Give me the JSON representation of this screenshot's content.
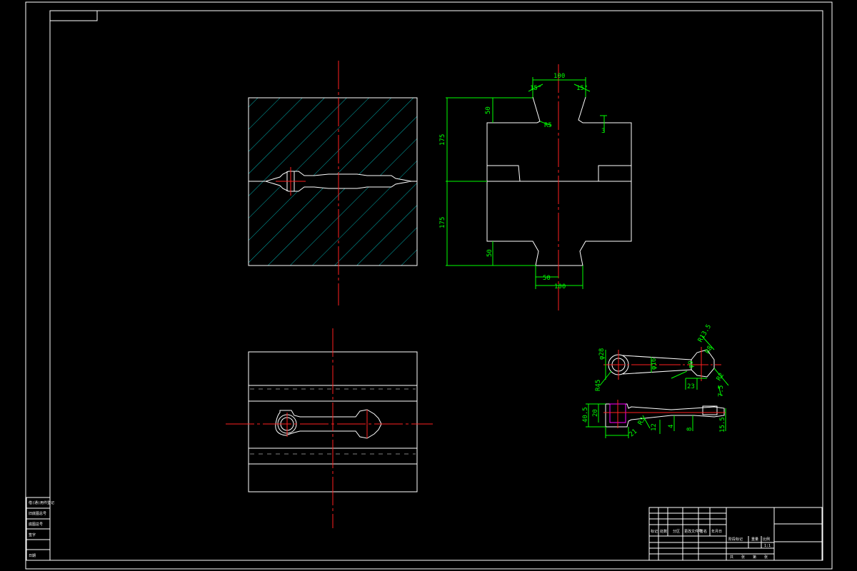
{
  "dimensions": {
    "top_width": "100",
    "top_left_angle": "15°",
    "top_right_angle": "15°",
    "top_radius": "R5",
    "left_top_depth": "50",
    "left_upper_height": "175",
    "left_lower_height": "175",
    "left_bottom_depth": "50",
    "right_notch": "3",
    "bottom_inner_width": "50",
    "bottom_outer_width": "100"
  },
  "part_top_view": {
    "d1": "φ28",
    "d2": "φ16",
    "d3": "R13.5",
    "d4": "R8",
    "d5": "φ9",
    "d6": "23",
    "d7": "7.5",
    "d8": "R45",
    "d9": "R2"
  },
  "part_side_view": {
    "s1": "40.5",
    "s2": "20",
    "s3": "21",
    "s4": "R3",
    "s5": "12",
    "s6": "4",
    "s7": "8",
    "s8": "15.5"
  },
  "title_block": {
    "row1": [
      "",
      "",
      "",
      "",
      "",
      "",
      ""
    ],
    "labels": [
      "标记",
      "处数",
      "分区",
      "更改文件号",
      "签名",
      "年月日"
    ],
    "stage_label": "阶段标记",
    "weight_label": "重量",
    "scale_label": "比例",
    "scale_value": "1:1",
    "sheet_labels": [
      "共",
      "张",
      "第",
      "张"
    ]
  },
  "left_strip": {
    "cells": [
      "借(通)用件登记",
      "旧底图总号",
      "底图总号",
      "签字",
      "日期"
    ]
  }
}
